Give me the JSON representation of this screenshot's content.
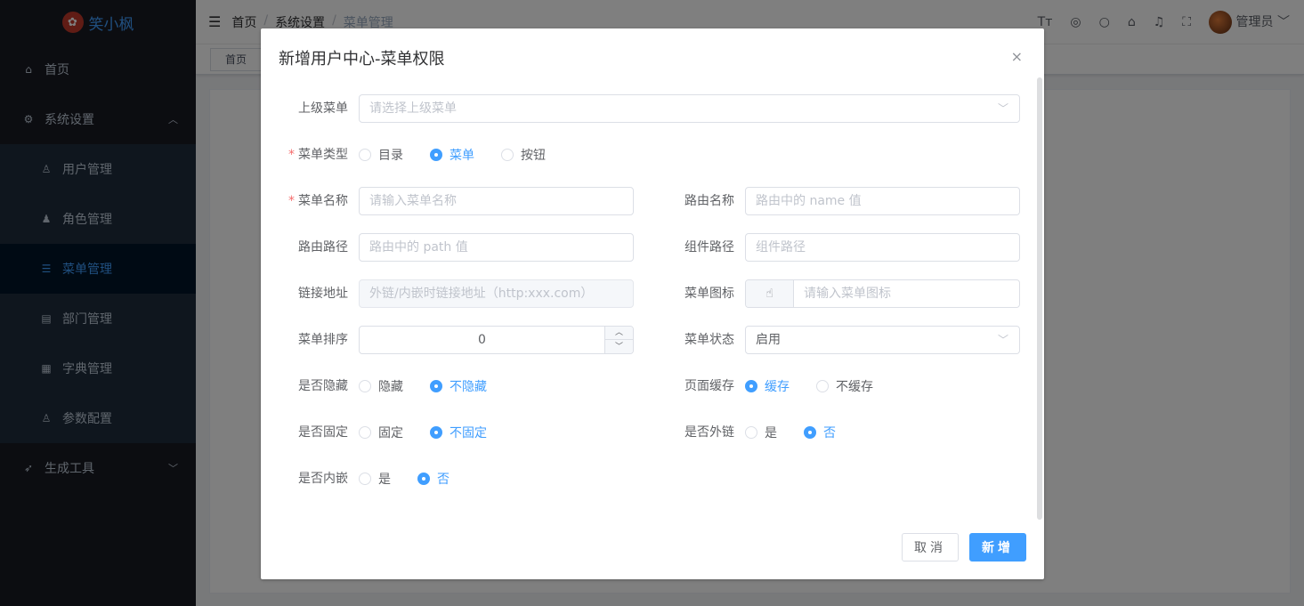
{
  "sidebar": {
    "logo_icon": "maple-leaf-icon",
    "logo_text": "笑小枫",
    "items": [
      {
        "label": "首页",
        "icon": "home-icon"
      },
      {
        "label": "系统设置",
        "icon": "gear-icon",
        "arrow": "^"
      },
      {
        "label": "用户管理",
        "icon": "user-icon"
      },
      {
        "label": "角色管理",
        "icon": "role-icon"
      },
      {
        "label": "菜单管理",
        "icon": "menu-tree-icon"
      },
      {
        "label": "部门管理",
        "icon": "department-icon"
      },
      {
        "label": "字典管理",
        "icon": "dictionary-icon"
      },
      {
        "label": "参数配置",
        "icon": "config-icon"
      },
      {
        "label": "生成工具",
        "icon": "rocket-icon",
        "arrow": "v"
      }
    ]
  },
  "navbar": {
    "breadcrumb": [
      "首页",
      "系统设置",
      "菜单管理"
    ],
    "user_name": "管理员"
  },
  "tags": [
    "首页"
  ],
  "dialog": {
    "title": "新增用户中心-菜单权限",
    "close": "×",
    "labels": {
      "parent": "上级菜单",
      "type": "菜单类型",
      "name": "菜单名称",
      "route_name": "路由名称",
      "route_path": "路由路径",
      "component": "组件路径",
      "link": "链接地址",
      "icon": "菜单图标",
      "sort": "菜单排序",
      "status": "菜单状态",
      "hidden": "是否隐藏",
      "cache": "页面缓存",
      "fixed": "是否固定",
      "external": "是否外链",
      "embed": "是否内嵌"
    },
    "placeholders": {
      "parent": "请选择上级菜单",
      "name": "请输入菜单名称",
      "route_name": "路由中的 name 值",
      "route_path": "路由中的 path 值",
      "component": "组件路径",
      "link": "外链/内嵌时链接地址（http:xxx.com）",
      "icon": "请输入菜单图标"
    },
    "values": {
      "sort": "0",
      "status": "启用"
    },
    "radios": {
      "type": [
        "目录",
        "菜单",
        "按钮"
      ],
      "hidden": [
        "隐藏",
        "不隐藏"
      ],
      "cache": [
        "缓存",
        "不缓存"
      ],
      "fixed": [
        "固定",
        "不固定"
      ],
      "external": [
        "是",
        "否"
      ],
      "embed": [
        "是",
        "否"
      ]
    },
    "selected": {
      "type": "菜单",
      "hidden": "不隐藏",
      "cache": "缓存",
      "fixed": "不固定",
      "external": "否",
      "embed": "否"
    },
    "buttons": {
      "cancel": "取消",
      "ok": "新增"
    }
  }
}
